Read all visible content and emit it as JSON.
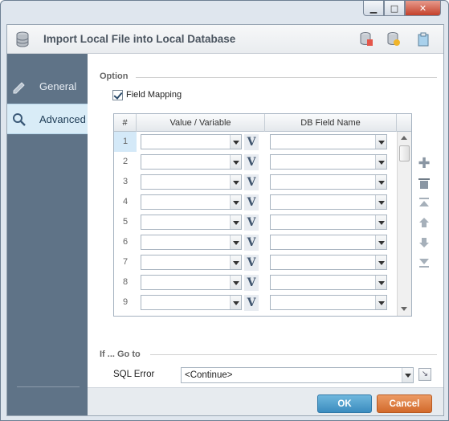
{
  "window": {
    "title": "Import Local File into Local Database",
    "buttons": {
      "minimize": "▁",
      "maximize": "□",
      "close": "✕"
    }
  },
  "header": {
    "icons": [
      "database-icon",
      "database-export-icon",
      "database-refresh-icon",
      "clipboard-icon"
    ]
  },
  "sidebar": {
    "items": [
      {
        "label": "General",
        "icon": "pencil-icon",
        "selected": false
      },
      {
        "label": "Advanced",
        "icon": "magnifier-icon",
        "selected": true
      }
    ]
  },
  "option": {
    "section_label": "Option",
    "field_mapping": {
      "label": "Field Mapping",
      "checked": true
    }
  },
  "grid": {
    "columns": [
      "#",
      "Value / Variable",
      "DB Field Name"
    ],
    "rows": [
      {
        "num": "1",
        "value": "",
        "db_field": "",
        "selected": true
      },
      {
        "num": "2",
        "value": "",
        "db_field": ""
      },
      {
        "num": "3",
        "value": "",
        "db_field": ""
      },
      {
        "num": "4",
        "value": "",
        "db_field": ""
      },
      {
        "num": "5",
        "value": "",
        "db_field": ""
      },
      {
        "num": "6",
        "value": "",
        "db_field": ""
      },
      {
        "num": "7",
        "value": "",
        "db_field": ""
      },
      {
        "num": "8",
        "value": "",
        "db_field": ""
      },
      {
        "num": "9",
        "value": "",
        "db_field": ""
      }
    ],
    "variable_button": "V",
    "side_buttons": [
      "add-icon",
      "delete-icon",
      "move-top-icon",
      "move-up-icon",
      "move-down-icon",
      "move-bottom-icon"
    ]
  },
  "goto": {
    "section_label": "If ... Go to",
    "sql_error_label": "SQL Error",
    "sql_error_value": "<Continue>"
  },
  "footer": {
    "ok_label": "OK",
    "cancel_label": "Cancel"
  },
  "colors": {
    "sidebar": "#5f7387",
    "sidebar_selected": "#d9ecf7",
    "ok_button": "#3b8cbf",
    "cancel_button": "#d26a2c"
  }
}
